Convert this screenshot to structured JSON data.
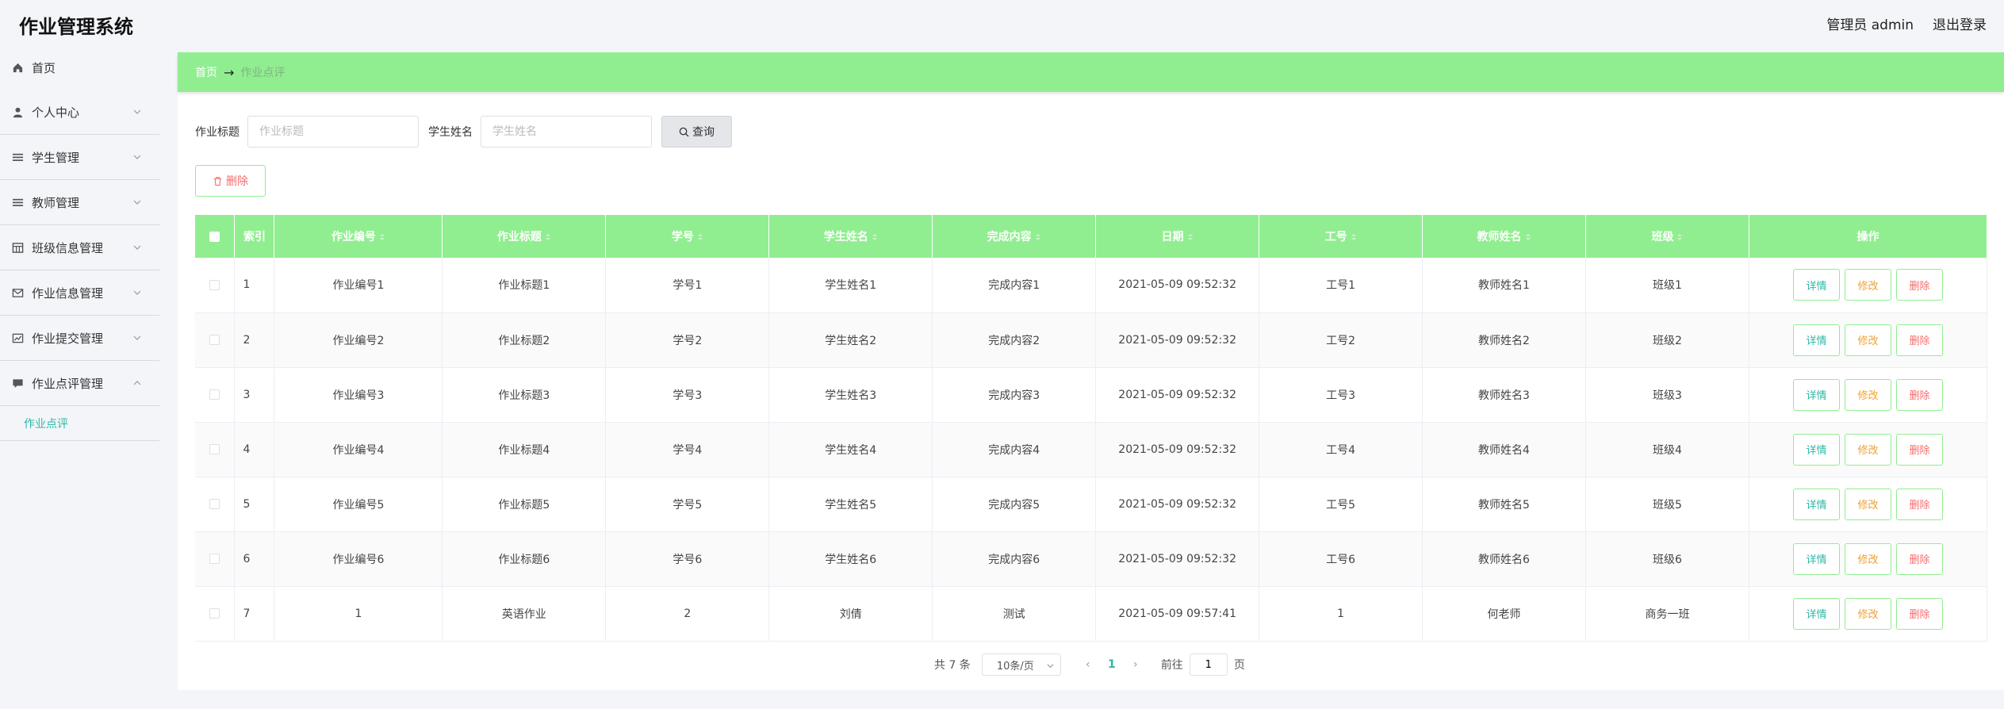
{
  "header": {
    "title": "作业管理系统",
    "user": "管理员 admin",
    "logout": "退出登录"
  },
  "sidebar": {
    "items": [
      {
        "label": "首页",
        "icon": "home-icon"
      },
      {
        "label": "个人中心",
        "icon": "user-icon"
      },
      {
        "label": "学生管理",
        "icon": "list-icon"
      },
      {
        "label": "教师管理",
        "icon": "list-icon"
      },
      {
        "label": "班级信息管理",
        "icon": "grid-icon"
      },
      {
        "label": "作业信息管理",
        "icon": "mail-icon"
      },
      {
        "label": "作业提交管理",
        "icon": "chart-icon"
      },
      {
        "label": "作业点评管理",
        "icon": "comment-icon"
      }
    ],
    "sub_item": "作业点评"
  },
  "breadcrumb": {
    "home": "首页",
    "current": "作业点评"
  },
  "search": {
    "title_label": "作业标题",
    "title_placeholder": "作业标题",
    "name_label": "学生姓名",
    "name_placeholder": "学生姓名",
    "query_label": "查询"
  },
  "bulk_delete_label": "删除",
  "table": {
    "headers": [
      "索引",
      "作业编号",
      "作业标题",
      "学号",
      "学生姓名",
      "完成内容",
      "日期",
      "工号",
      "教师姓名",
      "班级",
      "操作"
    ],
    "rows": [
      [
        "1",
        "作业编号1",
        "作业标题1",
        "学号1",
        "学生姓名1",
        "完成内容1",
        "2021-05-09 09:52:32",
        "工号1",
        "教师姓名1",
        "班级1"
      ],
      [
        "2",
        "作业编号2",
        "作业标题2",
        "学号2",
        "学生姓名2",
        "完成内容2",
        "2021-05-09 09:52:32",
        "工号2",
        "教师姓名2",
        "班级2"
      ],
      [
        "3",
        "作业编号3",
        "作业标题3",
        "学号3",
        "学生姓名3",
        "完成内容3",
        "2021-05-09 09:52:32",
        "工号3",
        "教师姓名3",
        "班级3"
      ],
      [
        "4",
        "作业编号4",
        "作业标题4",
        "学号4",
        "学生姓名4",
        "完成内容4",
        "2021-05-09 09:52:32",
        "工号4",
        "教师姓名4",
        "班级4"
      ],
      [
        "5",
        "作业编号5",
        "作业标题5",
        "学号5",
        "学生姓名5",
        "完成内容5",
        "2021-05-09 09:52:32",
        "工号5",
        "教师姓名5",
        "班级5"
      ],
      [
        "6",
        "作业编号6",
        "作业标题6",
        "学号6",
        "学生姓名6",
        "完成内容6",
        "2021-05-09 09:52:32",
        "工号6",
        "教师姓名6",
        "班级6"
      ],
      [
        "7",
        "1",
        "英语作业",
        "2",
        "刘倩",
        "测试",
        "2021-05-09 09:57:41",
        "1",
        "何老师",
        "商务一班"
      ]
    ],
    "actions": {
      "detail": "详情",
      "edit": "修改",
      "delete": "删除"
    }
  },
  "pagination": {
    "total": "共 7 条",
    "page_size": "10条/页",
    "current_page": "1",
    "goto_prefix": "前往",
    "goto_value": "1",
    "goto_suffix": "页"
  },
  "colors": {
    "accent": "#90ee90",
    "teal": "#2bb8a8",
    "danger": "#f56c6c",
    "warning": "#f0a030"
  }
}
